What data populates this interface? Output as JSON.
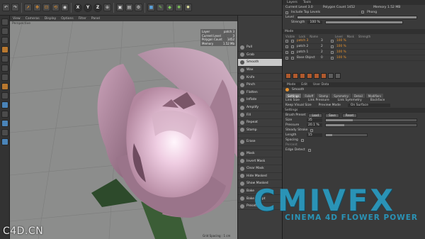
{
  "toolbar": {
    "icons": [
      "undo-icon",
      "redo-icon",
      "select-icon",
      "move-icon",
      "scale-icon",
      "rotate-icon",
      "recent-icon"
    ],
    "axes": [
      "X",
      "Y",
      "Z"
    ],
    "extra_icons": [
      "world-icon",
      "render-icon",
      "render-view-icon",
      "render-settings-icon",
      "cube-icon",
      "pen-icon",
      "subdivide-icon",
      "array-icon",
      "bulb-icon"
    ]
  },
  "viewport": {
    "menu": [
      "View",
      "Cameras",
      "Display",
      "Options",
      "Filter",
      "Panel"
    ],
    "camera_label": "Perspective",
    "info": {
      "rows": [
        {
          "label": "Layer",
          "value": "patch 3"
        },
        {
          "label": "Current Level",
          "value": "3"
        },
        {
          "label": "Polygon Count",
          "value": "1452"
        },
        {
          "label": "Memory",
          "value": "1.52 Mb"
        }
      ]
    },
    "grid_spacing": "Grid Spacing : 1 cm"
  },
  "brushes": {
    "items": [
      {
        "label": "Pull",
        "active": false
      },
      {
        "label": "Grab",
        "active": false
      },
      {
        "label": "Smooth",
        "active": true
      },
      {
        "label": "Wax",
        "active": false
      },
      {
        "label": "Knife",
        "active": false
      },
      {
        "label": "Pinch",
        "active": false
      },
      {
        "label": "Flatten",
        "active": false
      },
      {
        "label": "Inflate",
        "active": false
      },
      {
        "label": "Amplify",
        "active": false
      },
      {
        "label": "Fill",
        "active": false
      },
      {
        "label": "Repeat",
        "active": false
      },
      {
        "label": "Stamp",
        "active": false
      }
    ],
    "items2": [
      {
        "label": "Erase",
        "active": false
      }
    ],
    "items3": [
      {
        "label": "Mask",
        "active": false
      },
      {
        "label": "Invert Mask",
        "active": false
      },
      {
        "label": "Clear Mask",
        "active": false
      },
      {
        "label": "Hide Masked",
        "active": false
      },
      {
        "label": "Show Masked",
        "active": false
      },
      {
        "label": "Bake",
        "active": false
      },
      {
        "label": "Bake Sculpt",
        "active": false
      },
      {
        "label": "Preset",
        "active": false
      }
    ]
  },
  "layers_panel": {
    "tabs": [
      "Layers",
      "Tools"
    ],
    "current_level": "Current Level  3.0",
    "polygon_count": "Polygon Count  1452",
    "memory": "Memory  1.52 MB",
    "include_top": "Include Top Levels",
    "phong": "Phong",
    "level_label": "Level",
    "strength_label": "Strength",
    "strength_value": "100 %",
    "mode_label": "Mode",
    "columns": [
      "Visible",
      "Lock",
      "Name",
      "Level",
      "Mask",
      "Strength"
    ],
    "rows": [
      {
        "name": "patch 3",
        "level": "3",
        "strength": "100 %",
        "selected": true
      },
      {
        "name": "patch 2",
        "level": "2",
        "strength": "100 %",
        "selected": false
      },
      {
        "name": "patch 1",
        "level": "2",
        "strength": "100 %",
        "selected": false
      },
      {
        "name": "Base Object",
        "level": "0",
        "strength": "100 %",
        "selected": false
      }
    ]
  },
  "attributes_panel": {
    "menu": [
      "Mode",
      "Edit",
      "User Data"
    ],
    "tool_name": "Smooth",
    "tabs": [
      "Settings",
      "Falloff",
      "Stamp",
      "Symmetry",
      "Detail",
      "Modifiers"
    ],
    "link_size": "Link Size",
    "link_pressure": "Link Pressure",
    "link_symmetry": "Link Symmetry",
    "backface": "Backface",
    "keep_visual": "Keep Visual Size",
    "preview_mode": "Preview Mode",
    "preview_value": "On Surface",
    "settings_label": "Settings",
    "brush_preset": "Brush Preset",
    "preset_buttons": [
      "Load",
      "Save",
      "Reset"
    ],
    "size_label": "Size",
    "size_value": "35",
    "size_fill": 0.3,
    "pressure_label": "Pressure",
    "pressure_value": "20.1 %",
    "pressure_fill": 0.2,
    "steady_label": "Steady Stroke",
    "length_label": "Length",
    "length_value": "15",
    "length_fill": 0.15,
    "spacing_label": "Spacing",
    "percent_label": "Percent",
    "edge_detect": "Edge Detect"
  },
  "watermarks": {
    "site": "C4D.CN",
    "brand": "CMIVFX",
    "subtitle": "CINEMA 4D FLOWER POWER"
  },
  "colors": {
    "petal_light": "#f3d9ea",
    "petal_mid": "#b98ba6",
    "petal_dark": "#6d4a5f",
    "leaf": "#2c4a2a",
    "accent": "#e8922c",
    "brand": "#2a93b6"
  }
}
